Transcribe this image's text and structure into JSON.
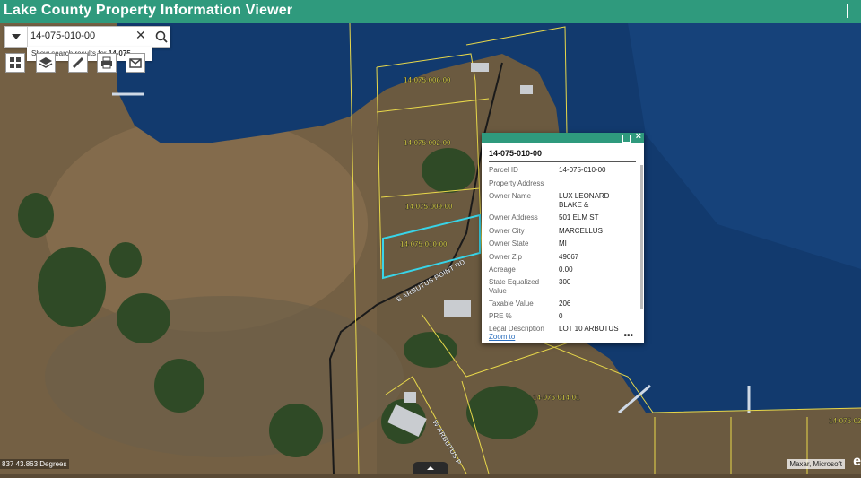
{
  "app": {
    "title": "Lake County Property Information Viewer"
  },
  "search": {
    "value": "14-075-010-00",
    "hint_prefix": "Show search results for ",
    "hint_term": "14-075..."
  },
  "toolbar": {
    "icons": [
      "basemap-gallery-icon",
      "layers-icon",
      "edit-icon",
      "print-icon",
      "email-icon"
    ]
  },
  "map": {
    "parcel_labels": [
      "14-075-006-00",
      "14-075-002-00",
      "14-075-009-00",
      "14-075-010-00",
      "14-075-014-01",
      "14-075-02"
    ],
    "road_labels": [
      "S ARBUTUS POINT RD",
      "W ARBUTUS P"
    ],
    "coordinates": "837 43.863 Degrees",
    "attribution": "Maxar, Microsoft",
    "logo_text": "e"
  },
  "popup": {
    "title": "14-075-010-00",
    "fields": [
      {
        "label": "Parcel ID",
        "value": "14-075-010-00"
      },
      {
        "label": "Property Address",
        "value": ""
      },
      {
        "label": "Owner Name",
        "value": "LUX LEONARD BLAKE &"
      },
      {
        "label": "Owner Address",
        "value": "501 ELM ST"
      },
      {
        "label": "Owner City",
        "value": "MARCELLUS"
      },
      {
        "label": "Owner State",
        "value": "MI"
      },
      {
        "label": "Owner Zip",
        "value": "49067"
      },
      {
        "label": "Acreage",
        "value": "0.00"
      },
      {
        "label": "State Equalized Value",
        "value": "300"
      },
      {
        "label": "Taxable Value",
        "value": "206"
      },
      {
        "label": "PRE %",
        "value": "0"
      },
      {
        "label": "Legal Description",
        "value": "LOT 10 ARBUTUS"
      }
    ],
    "zoom_label": "Zoom to",
    "more_label": "•••"
  },
  "colors": {
    "header": "#2f9a7d",
    "parcel_line": "#e8d84a",
    "selected_parcel": "#38d4e8",
    "lake": "#123a6e"
  }
}
